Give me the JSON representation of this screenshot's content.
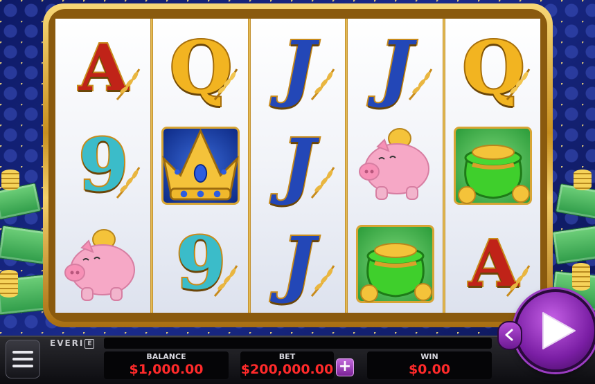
{
  "game": {
    "brand": "EVERI",
    "brand_mark": "E"
  },
  "reels": [
    {
      "symbols": [
        "A",
        "9",
        "piggy-bank"
      ]
    },
    {
      "symbols": [
        "Q",
        "crown",
        "9"
      ]
    },
    {
      "symbols": [
        "J",
        "J",
        "J"
      ]
    },
    {
      "symbols": [
        "J",
        "piggy-bank",
        "money-bag"
      ]
    },
    {
      "symbols": [
        "Q",
        "money-bag",
        "A"
      ]
    }
  ],
  "meters": {
    "balance_label": "BALANCE",
    "balance_value": "$1,000.00",
    "bet_label": "BET",
    "bet_value": "$200,000.00",
    "win_label": "WIN",
    "win_value": "$0.00"
  },
  "controls": {
    "menu_icon": "hamburger-icon",
    "bet_increase_icon": "plus-icon",
    "bet_increase_glyph": "+",
    "spin_icon": "play-icon",
    "back_icon": "chevron-left-icon"
  },
  "colors": {
    "meter_value": "#ff2a2a",
    "spin_button": "#9b3cc2",
    "frame_gold": "#e0b040"
  }
}
